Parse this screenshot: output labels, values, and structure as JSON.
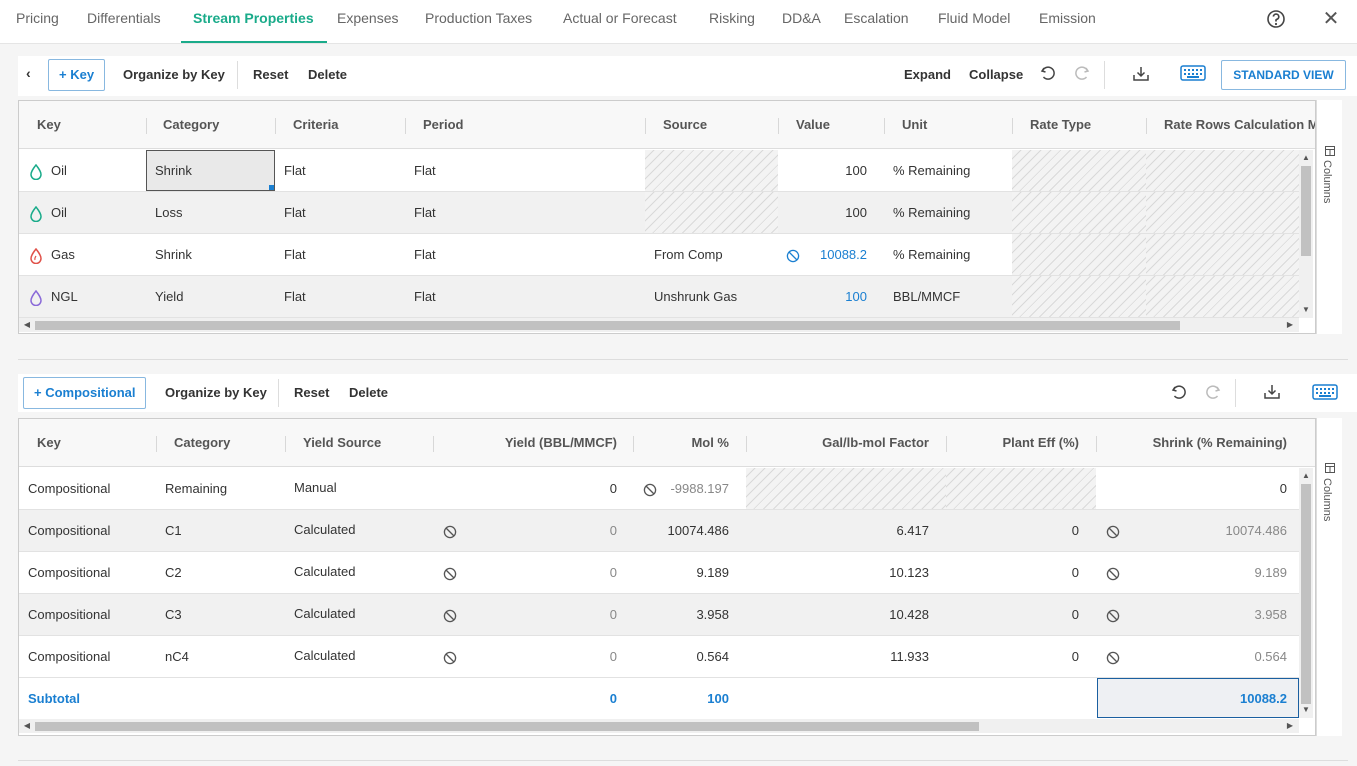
{
  "nav": {
    "tabs": [
      "Pricing",
      "Differentials",
      "Stream Properties",
      "Expenses",
      "Production Taxes",
      "Actual or Forecast",
      "Risking",
      "DD&A",
      "Escalation",
      "Fluid Model",
      "Emission"
    ],
    "active": "Stream Properties"
  },
  "top_toolbar": {
    "add_key": "+ Key",
    "organize": "Organize by Key",
    "reset": "Reset",
    "delete": "Delete",
    "expand": "Expand",
    "collapse": "Collapse",
    "standard_view": "STANDARD VIEW"
  },
  "top_grid": {
    "headers": [
      "Key",
      "Category",
      "Criteria",
      "Period",
      "Source",
      "Value",
      "Unit",
      "Rate Type",
      "Rate Rows Calculation M"
    ],
    "rows": [
      {
        "key": "Oil",
        "category": "Shrink",
        "criteria": "Flat",
        "period": "Flat",
        "source": "",
        "value": "100",
        "unit": "% Remaining"
      },
      {
        "key": "Oil",
        "category": "Loss",
        "criteria": "Flat",
        "period": "Flat",
        "source": "",
        "value": "100",
        "unit": "% Remaining"
      },
      {
        "key": "Gas",
        "category": "Shrink",
        "criteria": "Flat",
        "period": "Flat",
        "source": "From Comp",
        "value": "10088.2",
        "unit": "% Remaining"
      },
      {
        "key": "NGL",
        "category": "Yield",
        "criteria": "Flat",
        "period": "Flat",
        "source": "Unshrunk Gas",
        "value": "100",
        "unit": "BBL/MMCF"
      }
    ],
    "columns_label": "Columns"
  },
  "bottom_toolbar": {
    "add": "+ Compositional",
    "organize": "Organize by Key",
    "reset": "Reset",
    "delete": "Delete"
  },
  "bottom_grid": {
    "headers": [
      "Key",
      "Category",
      "Yield Source",
      "Yield (BBL/MMCF)",
      "Mol %",
      "Gal/lb-mol Factor",
      "Plant Eff (%)",
      "Shrink (% Remaining)"
    ],
    "rows": [
      {
        "key": "Compositional",
        "category": "Remaining",
        "source": "Manual",
        "yield": "0",
        "mol": "-9988.197",
        "gal": "",
        "eff": "",
        "shrink": "0"
      },
      {
        "key": "Compositional",
        "category": "C1",
        "source": "Calculated",
        "yield": "0",
        "mol": "10074.486",
        "gal": "6.417",
        "eff": "0",
        "shrink": "10074.486"
      },
      {
        "key": "Compositional",
        "category": "C2",
        "source": "Calculated",
        "yield": "0",
        "mol": "9.189",
        "gal": "10.123",
        "eff": "0",
        "shrink": "9.189"
      },
      {
        "key": "Compositional",
        "category": "C3",
        "source": "Calculated",
        "yield": "0",
        "mol": "3.958",
        "gal": "10.428",
        "eff": "0",
        "shrink": "3.958"
      },
      {
        "key": "Compositional",
        "category": "nC4",
        "source": "Calculated",
        "yield": "0",
        "mol": "0.564",
        "gal": "11.933",
        "eff": "0",
        "shrink": "0.564"
      }
    ],
    "subtotal": {
      "label": "Subtotal",
      "yield": "0",
      "mol": "100",
      "shrink": "10088.2"
    },
    "columns_label": "Columns"
  },
  "colors": {
    "accent_green": "#1aab8a",
    "accent_blue": "#1a7fd1",
    "oil": "#1aab8a",
    "gas": "#e0524a",
    "ngl": "#8a6ad8"
  },
  "icons": {
    "help": "help-circle-icon",
    "close": "close-icon",
    "undo": "undo-icon",
    "redo": "redo-icon",
    "export": "export-icon",
    "keyboard": "keyboard-icon",
    "no-sign": "no-sign-icon",
    "drop": "drop-icon"
  }
}
